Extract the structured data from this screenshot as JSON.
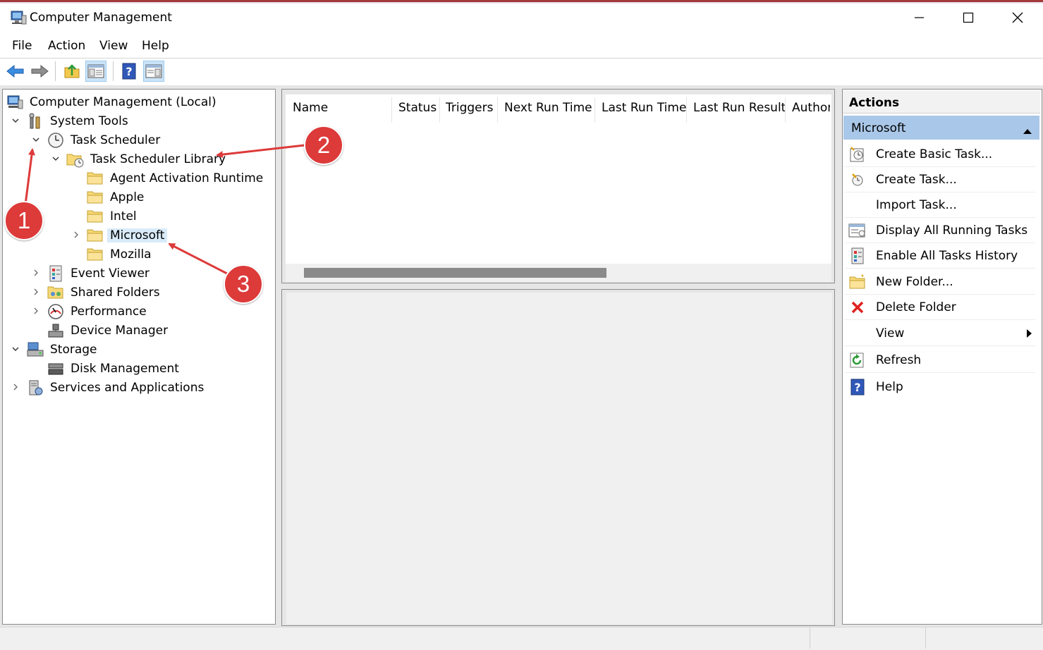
{
  "window": {
    "title": "Computer Management",
    "controls": [
      "minimize-icon",
      "maximize-icon",
      "close-icon"
    ]
  },
  "menu": [
    "File",
    "Action",
    "View",
    "Help"
  ],
  "toolbar": {
    "buttons": [
      "back-arrow-icon",
      "forward-arrow-icon",
      "up-folder-icon",
      "show-hide-tree-icon",
      "help-icon",
      "show-hide-action-pane-icon"
    ]
  },
  "tree": {
    "root": "Computer Management (Local)",
    "system_tools": "System Tools",
    "task_scheduler": "Task Scheduler",
    "library": "Task Scheduler Library",
    "agent": "Agent Activation Runtime",
    "apple": "Apple",
    "intel": "Intel",
    "microsoft": "Microsoft",
    "mozilla": "Mozilla",
    "event_viewer": "Event Viewer",
    "shared_folders": "Shared Folders",
    "performance": "Performance",
    "device_manager": "Device Manager",
    "storage": "Storage",
    "disk_management": "Disk Management",
    "services": "Services and Applications"
  },
  "task_list": {
    "columns": [
      "Name",
      "Status",
      "Triggers",
      "Next Run Time",
      "Last Run Time",
      "Last Run Result",
      "Author"
    ]
  },
  "actions": {
    "header": "Actions",
    "section": "Microsoft",
    "items": [
      "Create Basic Task...",
      "Create Task...",
      "Import Task...",
      "Display All Running Tasks",
      "Enable All Tasks History",
      "New Folder...",
      "Delete Folder",
      "View",
      "Refresh",
      "Help"
    ]
  },
  "callouts": [
    "1",
    "2",
    "3"
  ],
  "colors": {
    "accent_blue": "#2f73c9",
    "selection": "#d9ebf9",
    "actions_section": "#a9c7e8",
    "callout_red": "#dd3a3a",
    "delete_red": "#e02020"
  }
}
